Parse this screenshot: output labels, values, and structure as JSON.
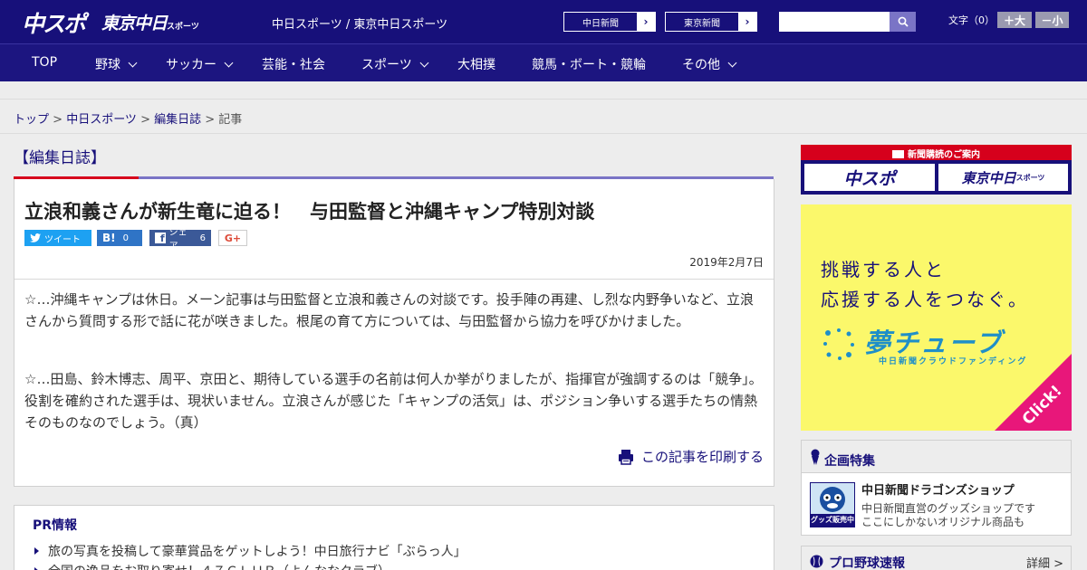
{
  "header": {
    "logo_main": "中スポ",
    "logo_tokyo": "東京中日",
    "logo_tokyo_small": "スポーツ",
    "site_names": "中日スポーツ / 東京中日スポーツ",
    "links": [
      "中日新聞",
      "東京新聞"
    ],
    "search_placeholder": "",
    "font_size_label": "文字（0）",
    "font_up": "＋大",
    "font_down": "－小"
  },
  "nav": {
    "items": [
      {
        "label": "TOP"
      },
      {
        "label": "野球"
      },
      {
        "label": "サッカー"
      },
      {
        "label": "芸能・社会"
      },
      {
        "label": "スポーツ"
      },
      {
        "label": "大相撲"
      },
      {
        "label": "競馬・ボート・競輪"
      },
      {
        "label": "その他"
      }
    ]
  },
  "breadcrumb": {
    "items": [
      "トップ",
      "中日スポーツ",
      "編集日誌"
    ],
    "sep": " > ",
    "current": "記事"
  },
  "article": {
    "section": "【編集日誌】",
    "title": "立浪和義さんが新生竜に迫る！　与田監督と沖縄キャンプ特別対談",
    "share": {
      "tweet": "ツイート",
      "hatena": "B!",
      "hatena_count": "0",
      "fb": "シェア",
      "fb_count": "6",
      "gplus": "G+"
    },
    "date": "2019年2月7日",
    "paragraphs": [
      "☆…沖縄キャンプは休日。メーン記事は与田監督と立浪和義さんの対談です。投手陣の再建、し烈な内野争いなど、立浪さんから質問する形で話に花が咲きました。根尾の育て方については、与田監督から協力を呼びかけました。",
      "☆…田島、鈴木博志、周平、京田と、期待している選手の名前は何人か挙がりましたが、指揮官が強調するのは「競争」。役割を確約された選手は、現状いません。立浪さんが感じた「キャンプの活気」は、ポジション争いする選手たちの情熱そのものなのでしょう。（真）"
    ],
    "print": "この記事を印刷する"
  },
  "pr": {
    "title": "PR情報",
    "items": [
      "旅の写真を投稿して豪華賞品をゲットしよう！中日旅行ナビ「ぶらっ人」",
      "全国の逸品をお取り寄せ！４７ＣＬＵＢ（よんななクラブ）"
    ]
  },
  "sidebar": {
    "subscription": {
      "head": "新聞購読のご案内",
      "btn1": "中スポ",
      "btn2": "東京中日",
      "btn2_small": "スポーツ"
    },
    "yume": {
      "line1": "挑戦する人と",
      "line2": "応援する人をつなぐ。",
      "brand": "夢チューブ",
      "sub": "中日新聞クラウドファンディング",
      "click": "Click!"
    },
    "feature": {
      "head": "企画特集",
      "thumb_label": "グッズ販売中",
      "title": "中日新聞ドラゴンズショップ",
      "desc1": "中日新聞直営のグッズショップです",
      "desc2": "ここにしかないオリジナル商品も"
    },
    "baseball": {
      "head": "プロ野球速報",
      "more": "詳細 >"
    }
  },
  "colors": {
    "brand_navy": "#17107a",
    "accent_red": "#d6001c",
    "accent_purple": "#7a74c6",
    "yume_yellow": "#fbf86b",
    "yume_pink": "#e8177a"
  }
}
